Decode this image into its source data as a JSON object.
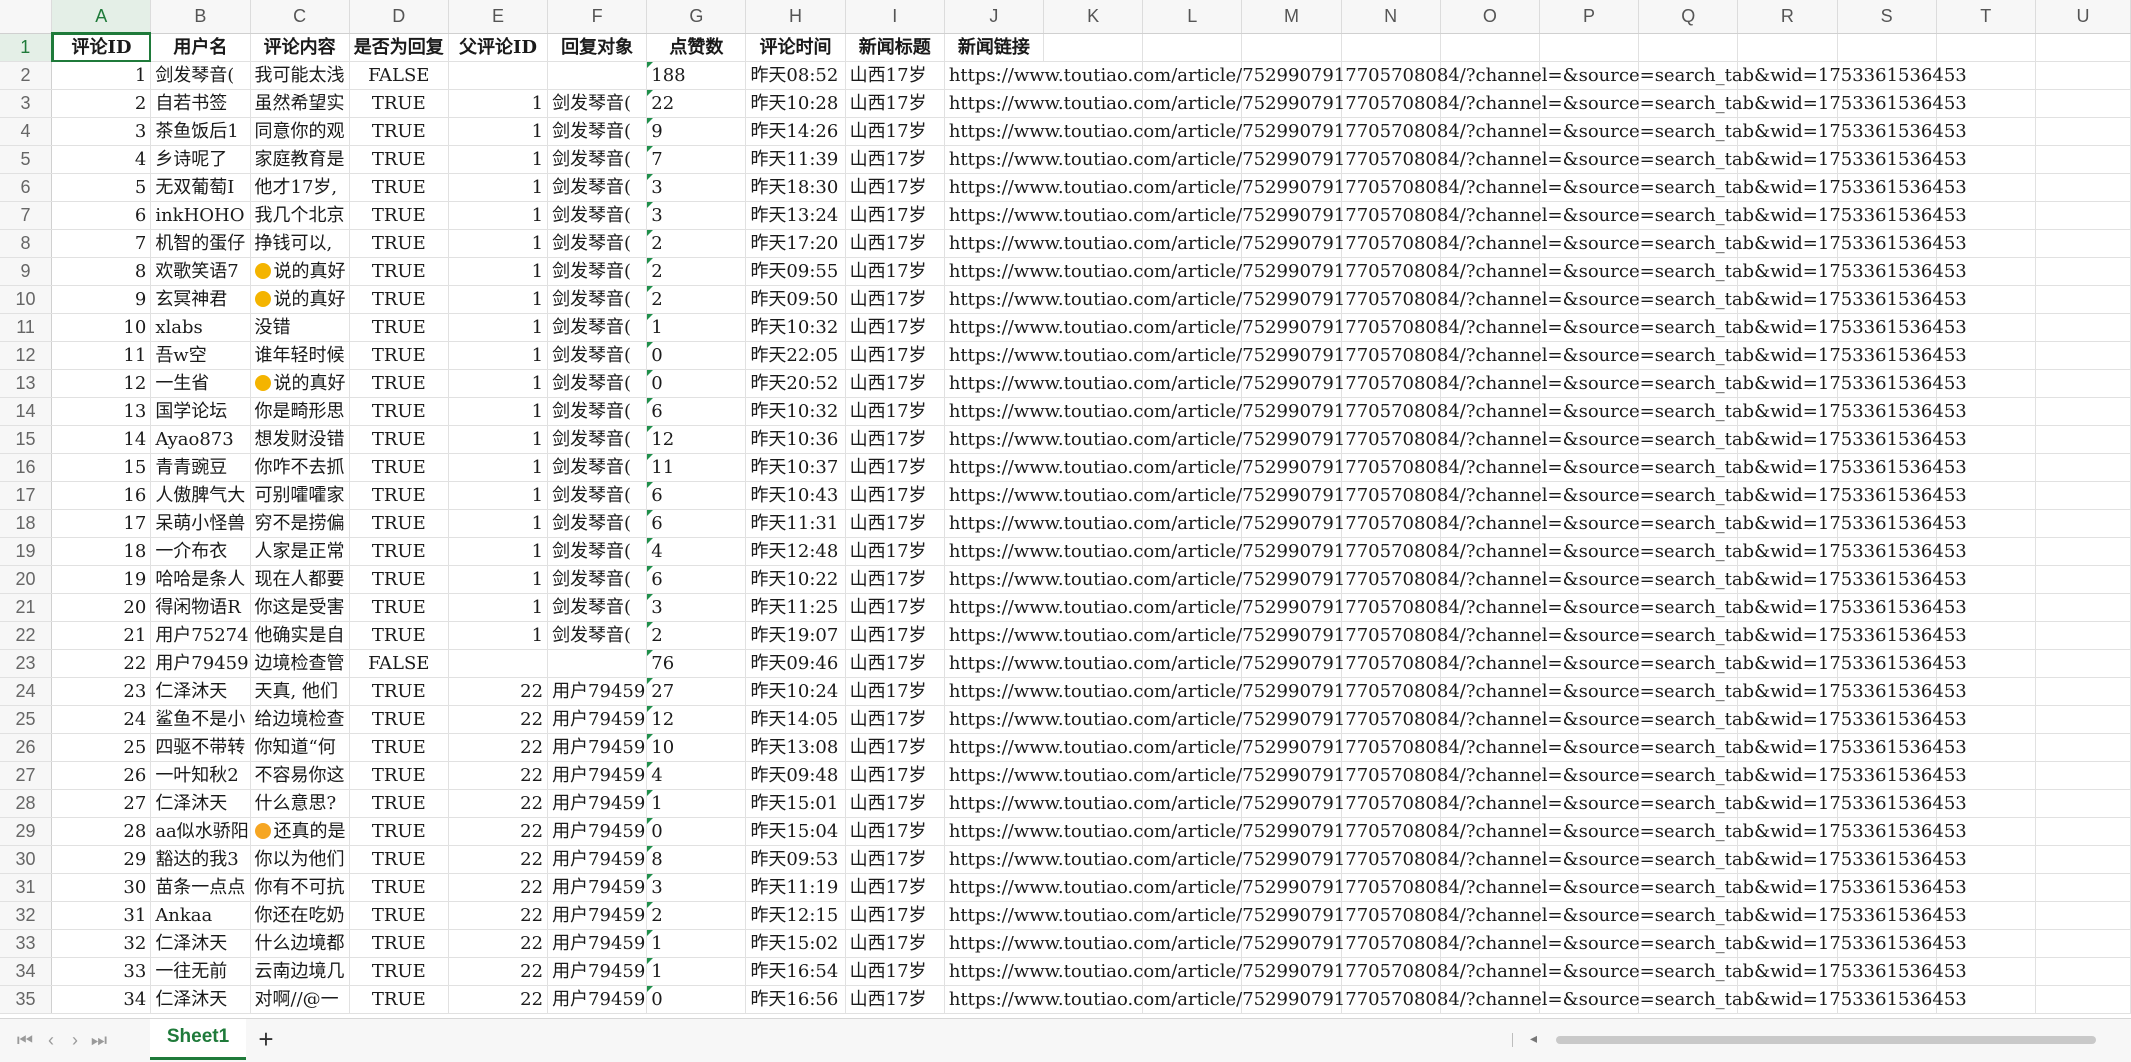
{
  "columns": [
    "A",
    "B",
    "C",
    "D",
    "E",
    "F",
    "G",
    "H",
    "I",
    "J",
    "K",
    "L",
    "M",
    "N",
    "O",
    "P",
    "Q",
    "R",
    "S",
    "T",
    "U"
  ],
  "active_column": "A",
  "active_row": 1,
  "headers": [
    "评论ID",
    "用户名",
    "评论内容",
    "是否为回复",
    "父评论ID",
    "回复对象",
    "点赞数",
    "评论时间",
    "新闻标题",
    "新闻链接"
  ],
  "rows": [
    {
      "r": "2",
      "id": "1",
      "user": "剑发琴音(",
      "content": "我可能太浅",
      "reply": "FALSE",
      "pid": "",
      "to": "",
      "likes": "188",
      "time": "昨天08:52",
      "title": "山西17岁",
      "url": "https://www.toutiao.com/article/7529907917705708084/?channel=&source=search_tab&wid=1753361536453"
    },
    {
      "r": "3",
      "id": "2",
      "user": "自若书签",
      "content": "虽然希望实",
      "reply": "TRUE",
      "pid": "1",
      "to": "剑发琴音(",
      "likes": "22",
      "time": "昨天10:28",
      "title": "山西17岁",
      "url": "https://www.toutiao.com/article/7529907917705708084/?channel=&source=search_tab&wid=1753361536453"
    },
    {
      "r": "4",
      "id": "3",
      "user": "茶鱼饭后1",
      "content": "同意你的观",
      "reply": "TRUE",
      "pid": "1",
      "to": "剑发琴音(",
      "likes": "9",
      "time": "昨天14:26",
      "title": "山西17岁",
      "url": "https://www.toutiao.com/article/7529907917705708084/?channel=&source=search_tab&wid=1753361536453"
    },
    {
      "r": "5",
      "id": "4",
      "user": "乡诗呢了",
      "content": "家庭教育是",
      "reply": "TRUE",
      "pid": "1",
      "to": "剑发琴音(",
      "likes": "7",
      "time": "昨天11:39",
      "title": "山西17岁",
      "url": "https://www.toutiao.com/article/7529907917705708084/?channel=&source=search_tab&wid=1753361536453"
    },
    {
      "r": "6",
      "id": "5",
      "user": "无双葡萄I",
      "content": "他才17岁,",
      "reply": "TRUE",
      "pid": "1",
      "to": "剑发琴音(",
      "likes": "3",
      "time": "昨天18:30",
      "title": "山西17岁",
      "url": "https://www.toutiao.com/article/7529907917705708084/?channel=&source=search_tab&wid=1753361536453"
    },
    {
      "r": "7",
      "id": "6",
      "user": "inkHOHO",
      "content": "我几个北京",
      "reply": "TRUE",
      "pid": "1",
      "to": "剑发琴音(",
      "likes": "3",
      "time": "昨天13:24",
      "title": "山西17岁",
      "url": "https://www.toutiao.com/article/7529907917705708084/?channel=&source=search_tab&wid=1753361536453"
    },
    {
      "r": "8",
      "id": "7",
      "user": "机智的蛋仔",
      "content": "挣钱可以,",
      "reply": "TRUE",
      "pid": "1",
      "to": "剑发琴音(",
      "likes": "2",
      "time": "昨天17:20",
      "title": "山西17岁",
      "url": "https://www.toutiao.com/article/7529907917705708084/?channel=&source=search_tab&wid=1753361536453"
    },
    {
      "r": "9",
      "id": "8",
      "user": "欢歌笑语7",
      "content": "说的真好",
      "emoji": "thumbs",
      "reply": "TRUE",
      "pid": "1",
      "to": "剑发琴音(",
      "likes": "2",
      "time": "昨天09:55",
      "title": "山西17岁",
      "url": "https://www.toutiao.com/article/7529907917705708084/?channel=&source=search_tab&wid=1753361536453"
    },
    {
      "r": "10",
      "id": "9",
      "user": "玄冥神君",
      "content": "说的真好",
      "emoji": "thumbs",
      "reply": "TRUE",
      "pid": "1",
      "to": "剑发琴音(",
      "likes": "2",
      "time": "昨天09:50",
      "title": "山西17岁",
      "url": "https://www.toutiao.com/article/7529907917705708084/?channel=&source=search_tab&wid=1753361536453"
    },
    {
      "r": "11",
      "id": "10",
      "user": "xlabs",
      "content": "没错",
      "reply": "TRUE",
      "pid": "1",
      "to": "剑发琴音(",
      "likes": "1",
      "time": "昨天10:32",
      "title": "山西17岁",
      "url": "https://www.toutiao.com/article/7529907917705708084/?channel=&source=search_tab&wid=1753361536453"
    },
    {
      "r": "12",
      "id": "11",
      "user": "吾w空",
      "content": "谁年轻时候",
      "reply": "TRUE",
      "pid": "1",
      "to": "剑发琴音(",
      "likes": "0",
      "time": "昨天22:05",
      "title": "山西17岁",
      "url": "https://www.toutiao.com/article/7529907917705708084/?channel=&source=search_tab&wid=1753361536453"
    },
    {
      "r": "13",
      "id": "12",
      "user": "一生省",
      "content": "说的真好",
      "emoji": "thumbs",
      "reply": "TRUE",
      "pid": "1",
      "to": "剑发琴音(",
      "likes": "0",
      "time": "昨天20:52",
      "title": "山西17岁",
      "url": "https://www.toutiao.com/article/7529907917705708084/?channel=&source=search_tab&wid=1753361536453"
    },
    {
      "r": "14",
      "id": "13",
      "user": "国学论坛",
      "content": "你是畸形思",
      "reply": "TRUE",
      "pid": "1",
      "to": "剑发琴音(",
      "likes": "6",
      "time": "昨天10:32",
      "title": "山西17岁",
      "url": "https://www.toutiao.com/article/7529907917705708084/?channel=&source=search_tab&wid=1753361536453"
    },
    {
      "r": "15",
      "id": "14",
      "user": "Ayao873",
      "content": "想发财没错",
      "reply": "TRUE",
      "pid": "1",
      "to": "剑发琴音(",
      "likes": "12",
      "time": "昨天10:36",
      "title": "山西17岁",
      "url": "https://www.toutiao.com/article/7529907917705708084/?channel=&source=search_tab&wid=1753361536453"
    },
    {
      "r": "16",
      "id": "15",
      "user": "青青豌豆",
      "content": "你咋不去抓",
      "reply": "TRUE",
      "pid": "1",
      "to": "剑发琴音(",
      "likes": "11",
      "time": "昨天10:37",
      "title": "山西17岁",
      "url": "https://www.toutiao.com/article/7529907917705708084/?channel=&source=search_tab&wid=1753361536453"
    },
    {
      "r": "17",
      "id": "16",
      "user": "人傲脾气大",
      "content": "可别嚯嚯家",
      "reply": "TRUE",
      "pid": "1",
      "to": "剑发琴音(",
      "likes": "6",
      "time": "昨天10:43",
      "title": "山西17岁",
      "url": "https://www.toutiao.com/article/7529907917705708084/?channel=&source=search_tab&wid=1753361536453"
    },
    {
      "r": "18",
      "id": "17",
      "user": "呆萌小怪兽",
      "content": "穷不是捞偏",
      "reply": "TRUE",
      "pid": "1",
      "to": "剑发琴音(",
      "likes": "6",
      "time": "昨天11:31",
      "title": "山西17岁",
      "url": "https://www.toutiao.com/article/7529907917705708084/?channel=&source=search_tab&wid=1753361536453"
    },
    {
      "r": "19",
      "id": "18",
      "user": "一介布衣",
      "content": "人家是正常",
      "reply": "TRUE",
      "pid": "1",
      "to": "剑发琴音(",
      "likes": "4",
      "time": "昨天12:48",
      "title": "山西17岁",
      "url": "https://www.toutiao.com/article/7529907917705708084/?channel=&source=search_tab&wid=1753361536453"
    },
    {
      "r": "20",
      "id": "19",
      "user": "哈哈是条人",
      "content": "现在人都要",
      "reply": "TRUE",
      "pid": "1",
      "to": "剑发琴音(",
      "likes": "6",
      "time": "昨天10:22",
      "title": "山西17岁",
      "url": "https://www.toutiao.com/article/7529907917705708084/?channel=&source=search_tab&wid=1753361536453"
    },
    {
      "r": "21",
      "id": "20",
      "user": "得闲物语R",
      "content": "你这是受害",
      "reply": "TRUE",
      "pid": "1",
      "to": "剑发琴音(",
      "likes": "3",
      "time": "昨天11:25",
      "title": "山西17岁",
      "url": "https://www.toutiao.com/article/7529907917705708084/?channel=&source=search_tab&wid=1753361536453"
    },
    {
      "r": "22",
      "id": "21",
      "user": "用户75274",
      "content": "他确实是自",
      "reply": "TRUE",
      "pid": "1",
      "to": "剑发琴音(",
      "likes": "2",
      "time": "昨天19:07",
      "title": "山西17岁",
      "url": "https://www.toutiao.com/article/7529907917705708084/?channel=&source=search_tab&wid=1753361536453"
    },
    {
      "r": "23",
      "id": "22",
      "user": "用户79459",
      "content": "边境检查管",
      "reply": "FALSE",
      "pid": "",
      "to": "",
      "likes": "76",
      "time": "昨天09:46",
      "title": "山西17岁",
      "url": "https://www.toutiao.com/article/7529907917705708084/?channel=&source=search_tab&wid=1753361536453"
    },
    {
      "r": "24",
      "id": "23",
      "user": "仁泽沐天",
      "content": "天真, 他们",
      "reply": "TRUE",
      "pid": "22",
      "to": "用户79459",
      "likes": "27",
      "time": "昨天10:24",
      "title": "山西17岁",
      "url": "https://www.toutiao.com/article/7529907917705708084/?channel=&source=search_tab&wid=1753361536453"
    },
    {
      "r": "25",
      "id": "24",
      "user": "鲨鱼不是小",
      "content": "给边境检查",
      "reply": "TRUE",
      "pid": "22",
      "to": "用户79459",
      "likes": "12",
      "time": "昨天14:05",
      "title": "山西17岁",
      "url": "https://www.toutiao.com/article/7529907917705708084/?channel=&source=search_tab&wid=1753361536453"
    },
    {
      "r": "26",
      "id": "25",
      "user": "四驱不带转",
      "content": "你知道“何",
      "reply": "TRUE",
      "pid": "22",
      "to": "用户79459",
      "likes": "10",
      "time": "昨天13:08",
      "title": "山西17岁",
      "url": "https://www.toutiao.com/article/7529907917705708084/?channel=&source=search_tab&wid=1753361536453"
    },
    {
      "r": "27",
      "id": "26",
      "user": "一叶知秋2",
      "content": "不容易你这",
      "reply": "TRUE",
      "pid": "22",
      "to": "用户79459",
      "likes": "4",
      "time": "昨天09:48",
      "title": "山西17岁",
      "url": "https://www.toutiao.com/article/7529907917705708084/?channel=&source=search_tab&wid=1753361536453"
    },
    {
      "r": "28",
      "id": "27",
      "user": "仁泽沐天",
      "content": "什么意思?",
      "reply": "TRUE",
      "pid": "22",
      "to": "用户79459",
      "likes": "1",
      "time": "昨天15:01",
      "title": "山西17岁",
      "url": "https://www.toutiao.com/article/7529907917705708084/?channel=&source=search_tab&wid=1753361536453"
    },
    {
      "r": "29",
      "id": "28",
      "user": "aa似水骄阳",
      "content": "还真的是",
      "emoji": "face",
      "reply": "TRUE",
      "pid": "22",
      "to": "用户79459",
      "likes": "0",
      "time": "昨天15:04",
      "title": "山西17岁",
      "url": "https://www.toutiao.com/article/7529907917705708084/?channel=&source=search_tab&wid=1753361536453"
    },
    {
      "r": "30",
      "id": "29",
      "user": "豁达的我3",
      "content": "你以为他们",
      "reply": "TRUE",
      "pid": "22",
      "to": "用户79459",
      "likes": "8",
      "time": "昨天09:53",
      "title": "山西17岁",
      "url": "https://www.toutiao.com/article/7529907917705708084/?channel=&source=search_tab&wid=1753361536453"
    },
    {
      "r": "31",
      "id": "30",
      "user": "苗条一点点",
      "content": "你有不可抗",
      "reply": "TRUE",
      "pid": "22",
      "to": "用户79459",
      "likes": "3",
      "time": "昨天11:19",
      "title": "山西17岁",
      "url": "https://www.toutiao.com/article/7529907917705708084/?channel=&source=search_tab&wid=1753361536453"
    },
    {
      "r": "32",
      "id": "31",
      "user": "Ankaa",
      "content": "你还在吃奶",
      "reply": "TRUE",
      "pid": "22",
      "to": "用户79459",
      "likes": "2",
      "time": "昨天12:15",
      "title": "山西17岁",
      "url": "https://www.toutiao.com/article/7529907917705708084/?channel=&source=search_tab&wid=1753361536453"
    },
    {
      "r": "33",
      "id": "32",
      "user": "仁泽沐天",
      "content": "什么边境都",
      "reply": "TRUE",
      "pid": "22",
      "to": "用户79459",
      "likes": "1",
      "time": "昨天15:02",
      "title": "山西17岁",
      "url": "https://www.toutiao.com/article/7529907917705708084/?channel=&source=search_tab&wid=1753361536453"
    },
    {
      "r": "34",
      "id": "33",
      "user": "一往无前",
      "content": "云南边境几",
      "reply": "TRUE",
      "pid": "22",
      "to": "用户79459",
      "likes": "1",
      "time": "昨天16:54",
      "title": "山西17岁",
      "url": "https://www.toutiao.com/article/7529907917705708084/?channel=&source=search_tab&wid=1753361536453"
    },
    {
      "r": "35",
      "id": "34",
      "user": "仁泽沐天",
      "content": "对啊//@一",
      "reply": "TRUE",
      "pid": "22",
      "to": "用户79459",
      "likes": "0",
      "time": "昨天16:56",
      "title": "山西17岁",
      "url": "https://www.toutiao.com/article/7529907917705708084/?channel=&source=search_tab&wid=1753361536453"
    }
  ],
  "tabbar": {
    "sheet_name": "Sheet1",
    "add_label": "+",
    "nav_first": "⏮",
    "nav_prev": "‹",
    "nav_next": "›",
    "nav_last": "⏭"
  },
  "colors": {
    "accent": "#1f7a3a",
    "flag": "#1f8f4a",
    "header_bg": "#f7f7f7"
  }
}
